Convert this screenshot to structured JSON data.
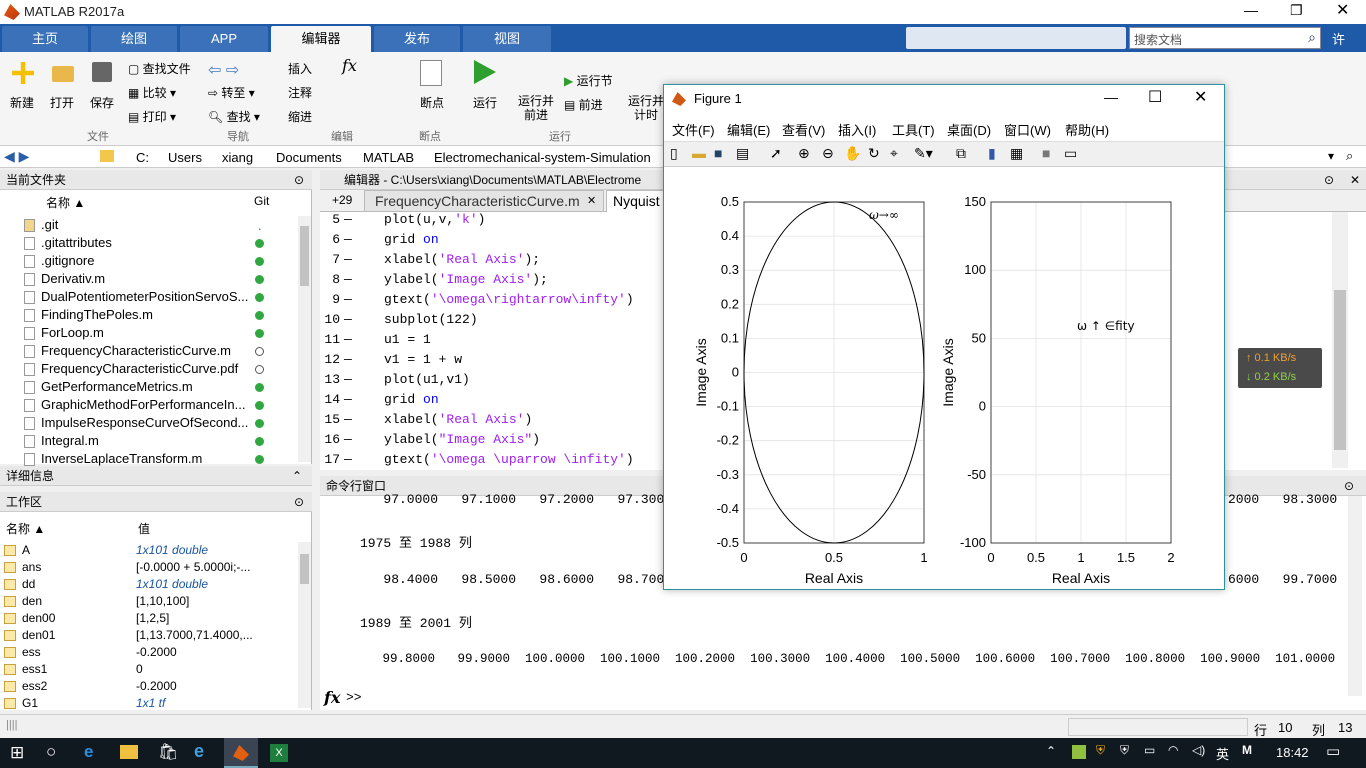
{
  "window": {
    "title": "MATLAB R2017a"
  },
  "ribbon_tabs": [
    "主页",
    "绘图",
    "APP",
    "编辑器",
    "发布",
    "视图"
  ],
  "search": {
    "placeholder": "搜索文档",
    "user": "许"
  },
  "ribbon": {
    "new": "新建",
    "open": "打开",
    "save": "保存",
    "find_files": "查找文件",
    "compare": "比较",
    "print": "打印",
    "goto": "转至",
    "find": "查找",
    "insert": "插入",
    "comment": "注释",
    "indent": "缩进",
    "fx": "fx",
    "breakpoints": "断点",
    "run": "运行",
    "run_advance": "运行并\n前进",
    "run_section": "运行节",
    "advance": "前进",
    "run_time": "运行并\n计时",
    "groups": [
      "文件",
      "导航",
      "编辑",
      "断点",
      "运行"
    ]
  },
  "address": [
    "C:",
    "Users",
    "xiang",
    "Documents",
    "MATLAB",
    "Electromechanical-system-Simulation"
  ],
  "current_folder": {
    "title": "当前文件夹",
    "col_name": "名称 ▲",
    "col_git": "Git",
    "files": [
      {
        "name": ".git",
        "git": "dot"
      },
      {
        "name": ".gitattributes",
        "git": "green"
      },
      {
        "name": ".gitignore",
        "git": "green"
      },
      {
        "name": "Derivativ.m",
        "git": "green"
      },
      {
        "name": "DualPotentiometerPositionServoS...",
        "git": "green"
      },
      {
        "name": "FindingThePoles.m",
        "git": "green"
      },
      {
        "name": "ForLoop.m",
        "git": "green"
      },
      {
        "name": "FrequencyCharacteristicCurve.m",
        "git": "open"
      },
      {
        "name": "FrequencyCharacteristicCurve.pdf",
        "git": "open"
      },
      {
        "name": "GetPerformanceMetrics.m",
        "git": "green"
      },
      {
        "name": "GraphicMethodForPerformanceIn...",
        "git": "green"
      },
      {
        "name": "ImpulseResponseCurveOfSecond...",
        "git": "green"
      },
      {
        "name": "Integral.m",
        "git": "green"
      },
      {
        "name": "InverseLaplaceTransform.m",
        "git": "green"
      }
    ]
  },
  "details": {
    "title": "详细信息"
  },
  "workspace": {
    "title": "工作区",
    "col_name": "名称 ▲",
    "col_value": "值",
    "vars": [
      {
        "name": "A",
        "value": "1x101 double",
        "italic": true
      },
      {
        "name": "ans",
        "value": "[-0.0000 + 5.0000i;-...",
        "italic": false
      },
      {
        "name": "dd",
        "value": "1x101 double",
        "italic": true
      },
      {
        "name": "den",
        "value": "[1,10,100]",
        "italic": false
      },
      {
        "name": "den00",
        "value": "[1,2,5]",
        "italic": false
      },
      {
        "name": "den01",
        "value": "[1,13.7000,71.4000,...",
        "italic": false
      },
      {
        "name": "ess",
        "value": "-0.2000",
        "italic": false
      },
      {
        "name": "ess1",
        "value": "0",
        "italic": false
      },
      {
        "name": "ess2",
        "value": "-0.2000",
        "italic": false
      },
      {
        "name": "G1",
        "value": "1x1 tf",
        "italic": true
      }
    ]
  },
  "editor": {
    "title": "编辑器 - C:\\Users\\xiang\\Documents\\MATLAB\\Electrome",
    "tab1": "FrequencyCharacteristicCurve.m",
    "tab2": "Nyquist",
    "fold_count": "+29"
  },
  "code_lines": [
    {
      "n": "5",
      "pre": "plot(u,v,",
      "str": "'k'",
      "post": ")"
    },
    {
      "n": "6",
      "pre": "grid ",
      "kw": "on"
    },
    {
      "n": "7",
      "pre": "xlabel(",
      "str": "'Real Axis'",
      "post": ");"
    },
    {
      "n": "8",
      "pre": "ylabel(",
      "str": "'Image Axis'",
      "post": ");"
    },
    {
      "n": "9",
      "pre": "gtext(",
      "str": "'\\omega\\rightarrow\\infty'",
      "post": ")"
    },
    {
      "n": "10",
      "pre": "subplot(122)"
    },
    {
      "n": "11",
      "pre": "u1 = 1"
    },
    {
      "n": "12",
      "pre": "v1 = 1 + w"
    },
    {
      "n": "13",
      "pre": "plot(u1,v1)"
    },
    {
      "n": "14",
      "pre": "grid ",
      "kw": "on"
    },
    {
      "n": "15",
      "pre": "xlabel(",
      "str": "'Real Axis'",
      "post": ")"
    },
    {
      "n": "16",
      "pre": "ylabel(",
      "str": "\"Image Axis\"",
      "post": ")"
    },
    {
      "n": "17",
      "pre": "gtext(",
      "str": "'\\omega \\uparrow \\infity'",
      "post": ")"
    }
  ],
  "command_window": {
    "title": "命令行窗口",
    "line1": "   97.0000   97.1000   97.2000   97.3000   97",
    "line1_right": "2000   98.3000",
    "hdr1": "1975 至 1988 列",
    "line2": "   98.4000   98.5000   98.6000   98.7000   98.",
    "line2_right": "6000   99.7000",
    "hdr2": "1989 至 2001 列",
    "line3": "   99.8000   99.9000  100.0000  100.1000  100.2000  100.3000  100.4000  100.5000  100.6000  100.7000  100.8000  100.9000  101.0000",
    "prompt": ">>"
  },
  "net": {
    "up": "↑ 0.1 KB/s",
    "down": "↓ 0.2 KB/s"
  },
  "figure": {
    "title": "Figure 1",
    "menu": [
      "文件(F)",
      "编辑(E)",
      "查看(V)",
      "插入(I)",
      "工具(T)",
      "桌面(D)",
      "窗口(W)",
      "帮助(H)"
    ]
  },
  "chart_data": [
    {
      "type": "line",
      "xlabel": "Real Axis",
      "ylabel": "Image Axis",
      "xlim": [
        0,
        1
      ],
      "ylim": [
        -0.5,
        0.5
      ],
      "xticks": [
        "0",
        "0.5",
        "1"
      ],
      "yticks": [
        "0.5",
        "0.4",
        "0.3",
        "0.2",
        "0.1",
        "0",
        "-0.1",
        "-0.2",
        "-0.3",
        "-0.4",
        "-0.5"
      ],
      "grid": true,
      "series": [
        {
          "shape": "circle",
          "center": [
            0.5,
            0
          ],
          "radius": 0.5,
          "color": "#000000"
        }
      ],
      "annotation": "ω→∞"
    },
    {
      "type": "line",
      "xlabel": "Real Axis",
      "ylabel": "Image Axis",
      "xlim": [
        0,
        2
      ],
      "ylim": [
        -100,
        150
      ],
      "xticks": [
        "0",
        "0.5",
        "1",
        "1.5",
        "2"
      ],
      "yticks": [
        "150",
        "100",
        "50",
        "0",
        "-50",
        "-100"
      ],
      "grid": true,
      "series": [],
      "annotation": "ω ↑ ∈fity"
    }
  ],
  "status": {
    "row_label": "行",
    "row": "10",
    "col_label": "列",
    "col": "13"
  },
  "taskbar": {
    "ime": "英",
    "time": "18:42"
  }
}
